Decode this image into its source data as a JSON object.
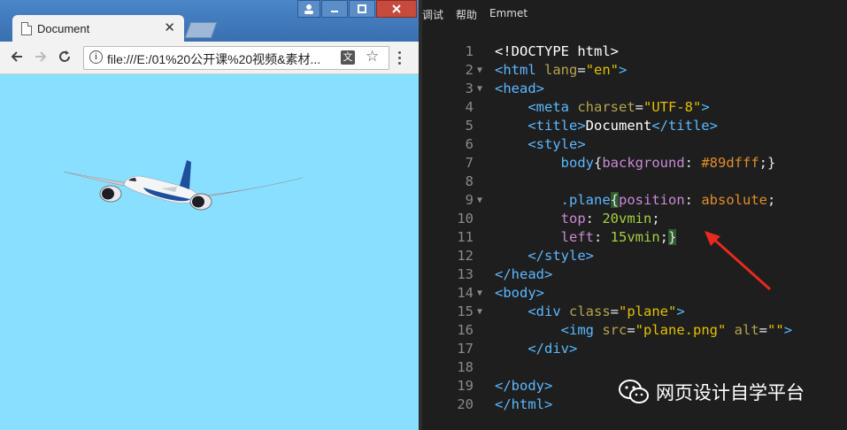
{
  "browser": {
    "tab_title": "Document",
    "url": "file:///E:/01%20公开课%20视频&素材...",
    "page": {
      "background": "#89dfff",
      "image_alt": "plane"
    }
  },
  "editor": {
    "menu": [
      "调试",
      "帮助",
      "Emmet"
    ],
    "lines": [
      {
        "n": "1",
        "fold": "",
        "html": "<span class=\"t-text\">&lt;!DOCTYPE html&gt;</span>"
      },
      {
        "n": "2",
        "fold": "▼",
        "html": "<span class=\"t-tag\">&lt;html</span> <span class=\"t-attr\">lang</span><span class=\"t-punc\">=</span><span class=\"t-str\">\"en\"</span><span class=\"t-tag\">&gt;</span>"
      },
      {
        "n": "3",
        "fold": "▼",
        "html": "<span class=\"t-tag\">&lt;head&gt;</span>"
      },
      {
        "n": "4",
        "fold": "",
        "html": "    <span class=\"t-tag\">&lt;meta</span> <span class=\"t-attr\">charset</span><span class=\"t-punc\">=</span><span class=\"t-str\">\"UTF-8\"</span><span class=\"t-tag\">&gt;</span>"
      },
      {
        "n": "5",
        "fold": "",
        "html": "    <span class=\"t-tag\">&lt;title&gt;</span><span class=\"t-text\">Document</span><span class=\"t-tag\">&lt;/title&gt;</span>"
      },
      {
        "n": "6",
        "fold": "",
        "html": "    <span class=\"t-tag\">&lt;style&gt;</span>"
      },
      {
        "n": "7",
        "fold": "",
        "html": "        <span class=\"t-tag\">body</span><span class=\"t-punc\">{</span><span class=\"t-prop\">background</span><span class=\"t-punc\">: </span><span class=\"t-val\">#89dfff</span><span class=\"t-punc\">;}</span>"
      },
      {
        "n": "8",
        "fold": "",
        "html": ""
      },
      {
        "n": "9",
        "fold": "▼",
        "html": "        <span class=\"t-tag\">.plane</span><span class=\"t-punc t-hl\">{</span><span class=\"t-prop\">position</span><span class=\"t-punc\">: </span><span class=\"t-val\">absolute</span><span class=\"t-punc\">;</span>"
      },
      {
        "n": "10",
        "fold": "",
        "html": "        <span class=\"t-prop\">top</span><span class=\"t-punc\">: </span><span class=\"t-num\">20vmin</span><span class=\"t-punc\">;</span>"
      },
      {
        "n": "11",
        "fold": "",
        "html": "        <span class=\"t-prop\">left</span><span class=\"t-punc\">: </span><span class=\"t-num\">15vmin</span><span class=\"t-punc\">;</span><span class=\"t-punc t-hl\">}</span>"
      },
      {
        "n": "12",
        "fold": "",
        "html": "    <span class=\"t-tag\">&lt;/style&gt;</span>"
      },
      {
        "n": "13",
        "fold": "",
        "html": "<span class=\"t-tag\">&lt;/head&gt;</span>"
      },
      {
        "n": "14",
        "fold": "▼",
        "html": "<span class=\"t-tag\">&lt;body&gt;</span>"
      },
      {
        "n": "15",
        "fold": "▼",
        "html": "    <span class=\"t-tag\">&lt;div</span> <span class=\"t-attr\">class</span><span class=\"t-punc\">=</span><span class=\"t-str\">\"plane\"</span><span class=\"t-tag\">&gt;</span>"
      },
      {
        "n": "16",
        "fold": "",
        "html": "        <span class=\"t-tag\">&lt;img</span> <span class=\"t-attr\">src</span><span class=\"t-punc\">=</span><span class=\"t-str\">\"plane.png\"</span> <span class=\"t-attr\">alt</span><span class=\"t-punc\">=</span><span class=\"t-str\">\"\"</span><span class=\"t-tag\">&gt;</span>"
      },
      {
        "n": "17",
        "fold": "",
        "html": "    <span class=\"t-tag\">&lt;/div&gt;</span>"
      },
      {
        "n": "18",
        "fold": "",
        "html": ""
      },
      {
        "n": "19",
        "fold": "",
        "html": "<span class=\"t-tag\">&lt;/body&gt;</span>"
      },
      {
        "n": "20",
        "fold": "",
        "html": "<span class=\"t-tag\">&lt;/html&gt;</span>"
      }
    ]
  },
  "watermark": {
    "text": "网页设计自学平台"
  },
  "colors": {
    "annotation_arrow": "#e8291f"
  }
}
